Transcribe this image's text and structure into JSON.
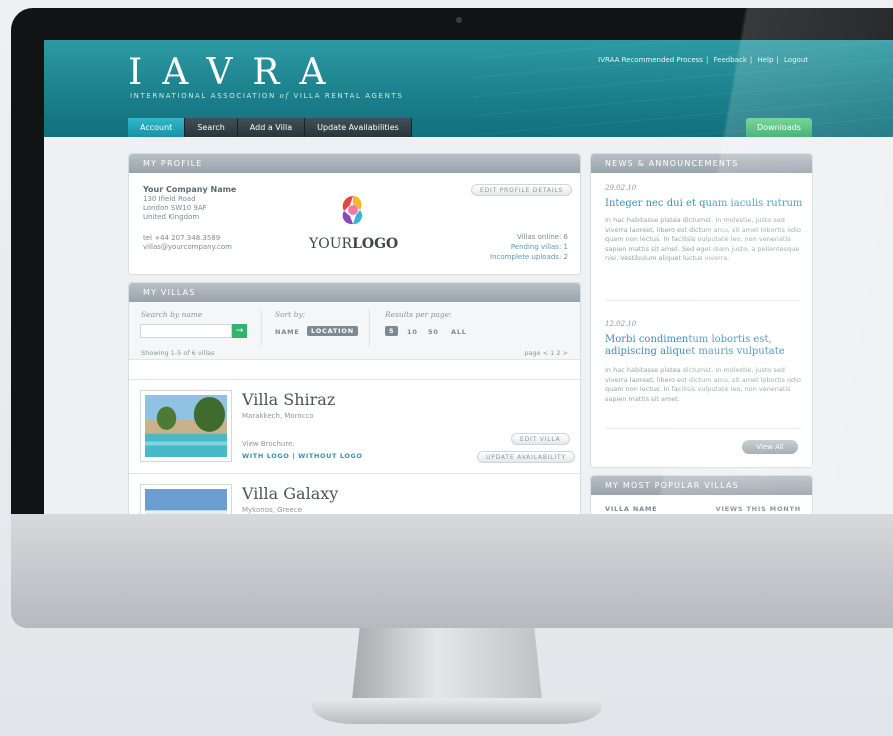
{
  "app": {
    "logo": "IAVRA",
    "tagline_pre": "INTERNATIONAL ASSOCIATION",
    "tagline_of": "of",
    "tagline_post": "VILLA RENTAL AGENTS"
  },
  "top_links": [
    "IVRAA Recommended Process",
    "Feedback",
    "Help",
    "Logout"
  ],
  "tabs": [
    {
      "label": "Account",
      "active": true
    },
    {
      "label": "Search",
      "active": false
    },
    {
      "label": "Add a Villa",
      "active": false
    },
    {
      "label": "Update Availabilities",
      "active": false
    }
  ],
  "downloads_label": "Downloads",
  "profile": {
    "heading": "MY PROFILE",
    "company": "Your Company Name",
    "address": [
      "130 Ifield Road",
      "London SW10 9AF",
      "United Kingdom"
    ],
    "tel": "tel +44 207.348.3589",
    "email": "villas@yourcompany.com",
    "logo_text_light": "YOUR",
    "logo_text_bold": "LOGO",
    "edit_label": "EDIT PROFILE DETAILS",
    "stats": [
      "Villas online: 6",
      "Pending villas: 1",
      "Incomplete uploads: 2"
    ]
  },
  "villas": {
    "heading": "MY VILLAS",
    "search_label": "Search by name",
    "search_value": "",
    "search_go": "→",
    "sort_label": "Sort by:",
    "sort_options": [
      {
        "label": "NAME",
        "selected": false
      },
      {
        "label": "LOCATION",
        "selected": true
      }
    ],
    "results_label": "Results per page:",
    "results_options": [
      {
        "label": "5",
        "selected": true
      },
      {
        "label": "10",
        "selected": false
      },
      {
        "label": "50",
        "selected": false
      },
      {
        "label": "ALL",
        "selected": false
      }
    ],
    "showing": "Showing 1-5 of 6 villas",
    "paging": "page < 1 2 >",
    "items": [
      {
        "name": "Villa Shiraz",
        "location": "Marakkech, Morocco",
        "brochure_label": "View Brochure:",
        "brochure_links": "WITH LOGO | WITHOUT LOGO",
        "edit_label": "EDIT VILLA",
        "update_label": "UPDATE AVAILABILITY"
      },
      {
        "name": "Villa Galaxy",
        "location": "Mykonos, Greece"
      }
    ]
  },
  "news": {
    "heading": "NEWS & ANNOUNCEMENTS",
    "items": [
      {
        "date": "29.02.10",
        "title": "Integer nec dui et quam iaculis rutrum",
        "body": "In hac habitasse platea dictumst. In molestie, justo sed viverra laoreet, libero est dictum arcu, sit amet lobortis odio quam non lectus. In facilisis vulputate leo, non venenatis sapien mattis sit amet. Sed eget diam justo, a pellentesque nisi. Vestibulum aliquet luctus viverra."
      },
      {
        "date": "12.02.10",
        "title": "Morbi condimentum lobortis est, adipiscing aliquet mauris vulputate",
        "body": "In hac habitasse platea dictumst. In molestie, justo sed viverra laoreet, libero est dictum arcu, sit amet lobortis odio quam non lectus. In facilisis vulputate leo, non venenatis sapien mattis sit amet."
      }
    ],
    "view_all": "View All"
  },
  "popular": {
    "heading": "MY MOST POPULAR VILLAS",
    "col_name": "VILLA NAME",
    "col_views": "VIEWS THIS MONTH"
  },
  "colors": {
    "header_teal": "#1a7f8a",
    "active_tab": "#1a92a8",
    "accent_green": "#2ea862",
    "link_blue": "#3c8fb4"
  },
  "icons": [
    "webcam-icon",
    "arrow-right-icon",
    "logo-mark-icon"
  ]
}
